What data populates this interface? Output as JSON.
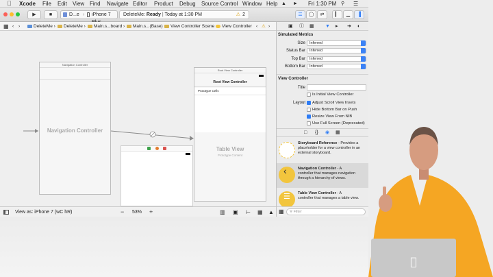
{
  "menubar": {
    "app_name": "Xcode",
    "items": [
      "File",
      "Edit",
      "View",
      "Find",
      "Navigate",
      "Editor",
      "Product",
      "Debug",
      "Source Control",
      "Window",
      "Help"
    ],
    "clock": "Fri 1:30 PM"
  },
  "toolbar": {
    "scheme_target": "D...e",
    "scheme_device": "iPhone 7 Plus",
    "status_app": "DeleteMe:",
    "status_state": "Ready",
    "status_time": "Today at 1:30 PM",
    "warning_count": "2"
  },
  "jumpbar": {
    "crumbs": [
      "DeleteMe",
      "DeleteMe",
      "Main.s...board",
      "Main.s...(Base)",
      "View Controller Scene",
      "View Controller"
    ]
  },
  "canvas": {
    "nav_controller_header": "Navigation Controller",
    "nav_controller_title": "Navigation Controller",
    "root_vc_header": "Root View Controller",
    "root_vc_navbar_title": "Root View Controller",
    "prototype_cells": "Prototype Cells",
    "table_view_title": "Table View",
    "table_view_sub": "Prototype Content"
  },
  "bottombar": {
    "view_as": "View as: iPhone 7 (wC hR)",
    "zoom_minus": "−",
    "zoom": "53%",
    "zoom_plus": "+"
  },
  "inspector": {
    "simulated_metrics_title": "Simulated Metrics",
    "metrics": [
      {
        "label": "Size",
        "value": "Inferred"
      },
      {
        "label": "Status Bar",
        "value": "Inferred"
      },
      {
        "label": "Top Bar",
        "value": "Inferred"
      },
      {
        "label": "Bottom Bar",
        "value": "Inferred"
      }
    ],
    "vc_section_title": "View Controller",
    "title_label": "Title",
    "initial_vc": "Is Initial View Controller",
    "layout_label": "Layout",
    "checkboxes": [
      {
        "label": "Adjust Scroll View Insets",
        "checked": true
      },
      {
        "label": "Hide Bottom Bar on Push",
        "checked": false
      },
      {
        "label": "Resize View From NIB",
        "checked": true
      },
      {
        "label": "Use Full Screen (Deprecated)",
        "checked": false
      }
    ]
  },
  "library": {
    "items": [
      {
        "title": "Storyboard Reference",
        "desc1": "- Provides a",
        "desc2": "placeholder for a view controller in an",
        "desc3": "external storyboard."
      },
      {
        "title": "Navigation Controller",
        "desc1": "- A",
        "desc2": "controller that manages navigation",
        "desc3": "through a hierarchy of views."
      },
      {
        "title": "Table View Controller",
        "desc1": "- A",
        "desc2": "controller that manages a table view.",
        "desc3": ""
      }
    ],
    "filter_placeholder": "Filter"
  },
  "colors": {
    "accent": "#2d7cf6",
    "nav_selected_bg": "#d9d9d9",
    "library_icon_yellow": "#f2c53d"
  }
}
